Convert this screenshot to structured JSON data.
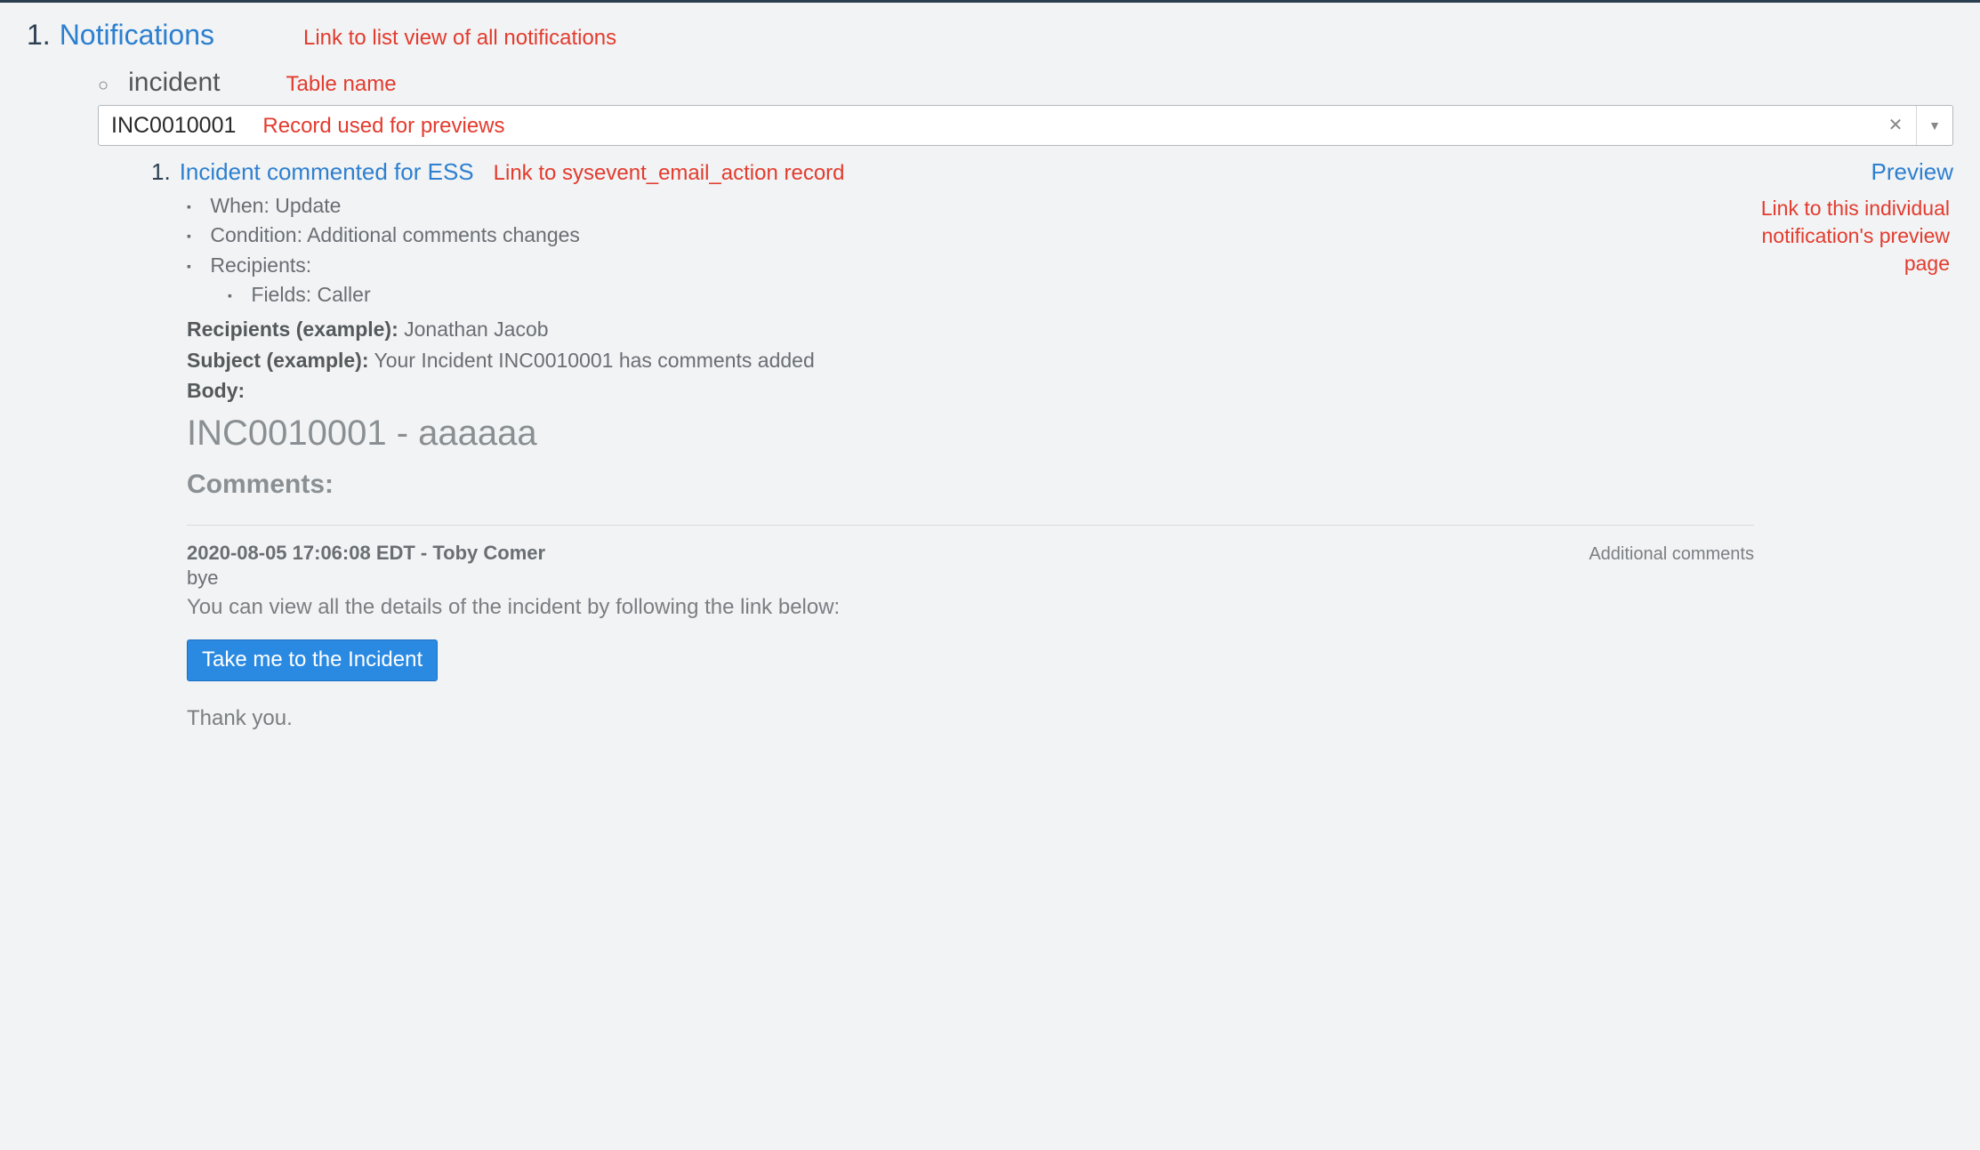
{
  "top": {
    "num": "1.",
    "label": "Notifications",
    "annotation": "Link to list view of all notifications"
  },
  "table": {
    "bullet": "○",
    "name": "incident",
    "annotation": "Table name"
  },
  "record": {
    "value": "INC0010001",
    "annotation": "Record used for previews"
  },
  "notification": {
    "num": "1.",
    "link_label": "Incident commented for ESS",
    "link_annotation": "Link to sysevent_email_action record",
    "preview_label": "Preview",
    "preview_annotation": "Link to this individual notification's preview page",
    "details": {
      "when_label": "When:",
      "when_value": "Update",
      "condition_label": "Condition:",
      "condition_value": "Additional comments changes",
      "recipients_label": "Recipients:",
      "recipients_fields_label": "Fields:",
      "recipients_fields_value": "Caller",
      "recipients_example_label": "Recipients (example):",
      "recipients_example_value": "Jonathan Jacob",
      "subject_example_label": "Subject (example):",
      "subject_example_value": "Your Incident INC0010001 has comments added",
      "body_label": "Body:"
    },
    "body": {
      "title": "INC0010001 - aaaaaa",
      "comments_heading": "Comments:",
      "comment_meta": "2020-08-05 17:06:08 EDT - Toby Comer",
      "comment_tag": "Additional comments",
      "comment_text": "bye",
      "follow_text": "You can view all the details of the incident by following the link below:",
      "cta_label": "Take me to the Incident",
      "thanks": "Thank you."
    }
  }
}
